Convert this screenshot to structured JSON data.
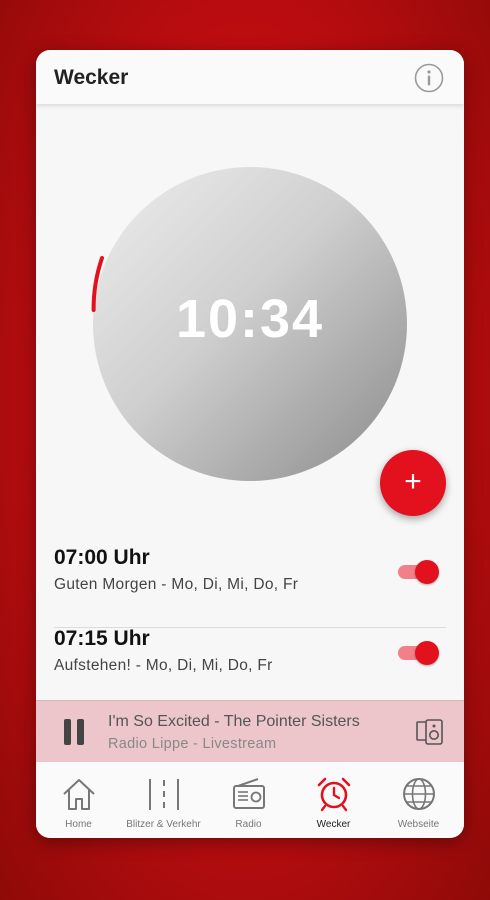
{
  "header": {
    "title": "Wecker",
    "info_icon": "info-icon"
  },
  "clock": {
    "time": "10:34"
  },
  "fab": {
    "label": "+",
    "icon": "add-icon"
  },
  "alarms": [
    {
      "time": "07:00 Uhr",
      "description": "Guten Morgen - Mo, Di, Mi, Do, Fr",
      "enabled": true
    },
    {
      "time": "07:15 Uhr",
      "description": "Aufstehen!  - Mo, Di, Mi, Do, Fr",
      "enabled": true
    }
  ],
  "player": {
    "title": "I'm So Excited - The Pointer Sisters",
    "station": "Radio Lippe - Livestream",
    "state_icon": "pause-icon",
    "output_icon": "speaker-icon"
  },
  "nav": [
    {
      "label": "Home",
      "icon": "home-icon"
    },
    {
      "label": "Blitzer & Verkehr",
      "icon": "road-icon"
    },
    {
      "label": "Radio",
      "icon": "radio-icon"
    },
    {
      "label": "Wecker",
      "icon": "alarm-clock-icon",
      "active": true
    },
    {
      "label": "Webseite",
      "icon": "globe-icon"
    }
  ],
  "colors": {
    "accent": "#e3101d",
    "background": "#c40d12",
    "card": "#f7f7f7",
    "player": "#ecc6ca"
  }
}
